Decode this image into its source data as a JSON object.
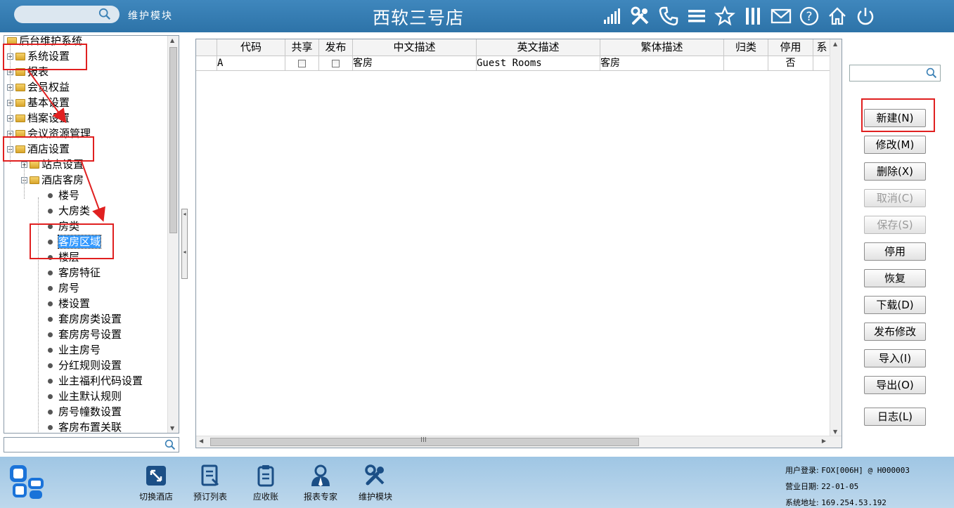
{
  "header": {
    "module_label": "维护模块",
    "app_title": "西软三号店",
    "search_placeholder": "",
    "icons": [
      "signal-icon",
      "tools-icon",
      "phone-icon",
      "menu-icon",
      "star-icon",
      "columns-icon",
      "mail-icon",
      "help-icon",
      "home-icon",
      "power-icon"
    ]
  },
  "tree": {
    "items": [
      {
        "label": "后台维护系统",
        "kind": "folder",
        "level": 0,
        "expand": ""
      },
      {
        "label": "系统设置",
        "kind": "folder",
        "level": 0,
        "expand": "+"
      },
      {
        "label": "报表",
        "kind": "folder",
        "level": 0,
        "expand": "+"
      },
      {
        "label": "会员权益",
        "kind": "folder",
        "level": 0,
        "expand": "+"
      },
      {
        "label": "基本设置",
        "kind": "folder",
        "level": 0,
        "expand": "+"
      },
      {
        "label": "档案设置",
        "kind": "folder",
        "level": 0,
        "expand": "+"
      },
      {
        "label": "会议资源管理",
        "kind": "folder",
        "level": 0,
        "expand": "+"
      },
      {
        "label": "酒店设置",
        "kind": "folder",
        "level": 0,
        "expand": "-"
      },
      {
        "label": "站点设置",
        "kind": "folder",
        "level": 1,
        "expand": "+"
      },
      {
        "label": "酒店客房",
        "kind": "folder",
        "level": 1,
        "expand": "-"
      },
      {
        "label": "楼号",
        "kind": "leaf",
        "level": 2
      },
      {
        "label": "大房类",
        "kind": "leaf",
        "level": 2
      },
      {
        "label": "房类",
        "kind": "leaf",
        "level": 2
      },
      {
        "label": "客房区域",
        "kind": "leaf",
        "level": 2,
        "selected": true
      },
      {
        "label": "楼层",
        "kind": "leaf",
        "level": 2
      },
      {
        "label": "客房特征",
        "kind": "leaf",
        "level": 2
      },
      {
        "label": "房号",
        "kind": "leaf",
        "level": 2
      },
      {
        "label": "楼设置",
        "kind": "leaf",
        "level": 2
      },
      {
        "label": "套房房类设置",
        "kind": "leaf",
        "level": 2
      },
      {
        "label": "套房房号设置",
        "kind": "leaf",
        "level": 2
      },
      {
        "label": "业主房号",
        "kind": "leaf",
        "level": 2
      },
      {
        "label": "分红规则设置",
        "kind": "leaf",
        "level": 2
      },
      {
        "label": "业主福利代码设置",
        "kind": "leaf",
        "level": 2
      },
      {
        "label": "业主默认规则",
        "kind": "leaf",
        "level": 2
      },
      {
        "label": "房号幢数设置",
        "kind": "leaf",
        "level": 2
      },
      {
        "label": "客房布置关联",
        "kind": "leaf",
        "level": 2
      }
    ],
    "search_value": ""
  },
  "grid": {
    "columns": [
      "",
      "代码",
      "共享",
      "发布",
      "中文描述",
      "英文描述",
      "繁体描述",
      "归类",
      "停用",
      "系"
    ],
    "rows": [
      {
        "code": "A",
        "shared": false,
        "published": false,
        "cn": "客房",
        "en": "Guest Rooms",
        "tw": "客房",
        "category": "",
        "disabled": "否"
      }
    ],
    "scroll_grip": "III"
  },
  "actions": {
    "search_value": "",
    "buttons": [
      {
        "label": "新建(N)",
        "enabled": true
      },
      {
        "label": "修改(M)",
        "enabled": true
      },
      {
        "label": "删除(X)",
        "enabled": true
      },
      {
        "label": "取消(C)",
        "enabled": false
      },
      {
        "label": "保存(S)",
        "enabled": false
      },
      {
        "label": "停用",
        "enabled": true
      },
      {
        "label": "恢复",
        "enabled": true
      },
      {
        "label": "下载(D)",
        "enabled": true
      },
      {
        "label": "发布修改",
        "enabled": true
      },
      {
        "label": "导入(I)",
        "enabled": true
      },
      {
        "label": "导出(O)",
        "enabled": true
      },
      {
        "label": "日志(L)",
        "enabled": true
      }
    ]
  },
  "bottom_nav": [
    {
      "label": "切换酒店",
      "icon": "switch-hotel-icon"
    },
    {
      "label": "预订列表",
      "icon": "booking-list-icon"
    },
    {
      "label": "应收账",
      "icon": "receivable-icon"
    },
    {
      "label": "报表专家",
      "icon": "report-expert-icon"
    },
    {
      "label": "维护模块",
      "icon": "maintenance-icon"
    }
  ],
  "status": {
    "user_label": "用户登录:",
    "user_value": "FOX[006H] @ H000003",
    "date_label": "营业日期:",
    "date_value": "22-01-05",
    "addr_label": "系统地址:",
    "addr_value": "169.254.53.192"
  },
  "colors": {
    "topbar": "#3a80b5",
    "bottombar": "#afd0e9",
    "annotation_red": "#e02020",
    "selection": "#3399ff"
  }
}
